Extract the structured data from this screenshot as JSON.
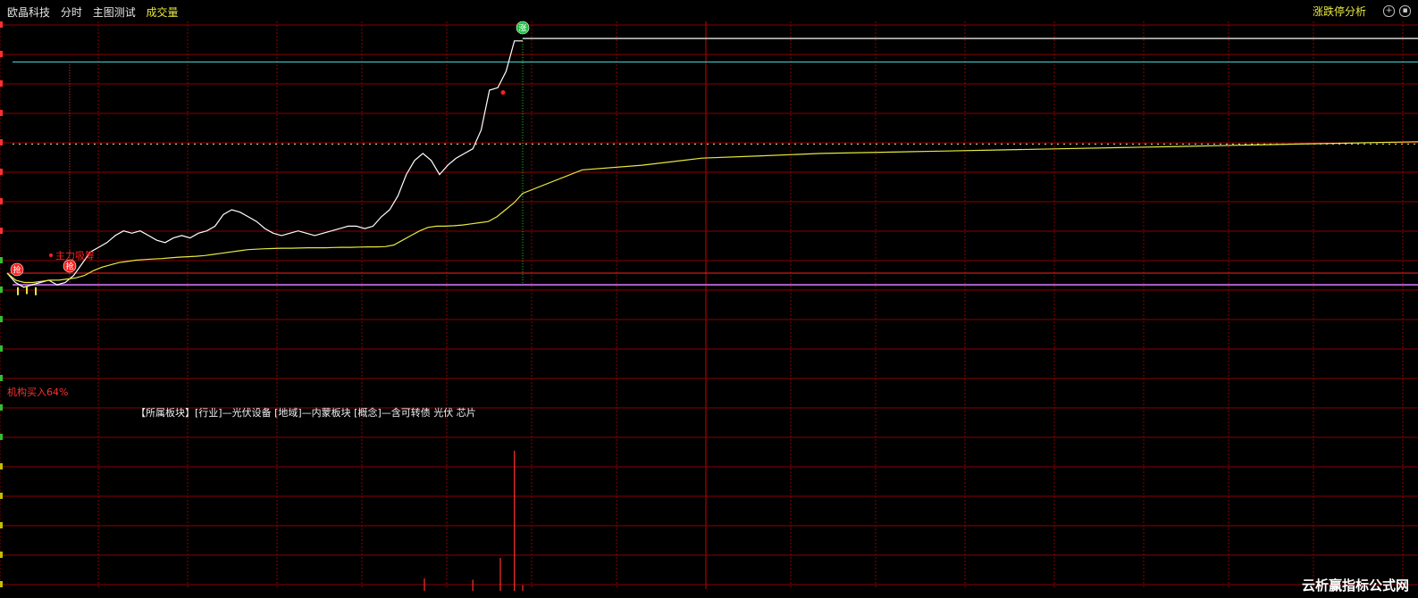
{
  "header": {
    "stock_name": "欧晶科技",
    "view_mode": "分时",
    "indicator_name": "主图测试",
    "volume_label": "成交量",
    "analysis_link": "涨跌停分析"
  },
  "annotations": {
    "main_buy_label": "主力吸筹",
    "institution_buy_label": "机构买入64%",
    "sector_line": "【所属板块】[行业]—光伏设备 [地域]—内蒙板块 [概念]—含可转债 光伏 芯片",
    "signal_low": "抢",
    "signal_limit": "涨"
  },
  "watermark": "云析赢指标公式网",
  "colors": {
    "grid": "#8b0000",
    "price_line": "#ffffff",
    "avg_line": "#e8e840",
    "limit_line": "#40c8c8",
    "support_line": "#b060d0",
    "dotted_line": "#e8e8a0",
    "volume_bar": "#ff3030",
    "signal_red": "#ff2020",
    "signal_green": "#20c040"
  },
  "chart_data": {
    "type": "line",
    "series": [
      {
        "values": [
          0.0,
          -0.4,
          -0.6,
          -0.5,
          -0.4,
          -0.3,
          -0.5,
          -0.4,
          -0.1,
          0.4,
          0.9,
          1.1,
          1.3,
          1.6,
          1.8,
          1.7,
          1.8,
          1.6,
          1.4,
          1.3,
          1.5,
          1.6,
          1.5,
          1.7,
          1.8,
          2.0,
          2.5,
          2.7,
          2.6,
          2.4,
          2.2,
          1.9,
          1.7,
          1.6,
          1.7,
          1.8,
          1.7,
          1.6,
          1.7,
          1.8,
          1.9,
          2.0,
          2.0,
          1.9,
          2.0,
          2.4,
          2.7,
          3.3,
          4.2,
          4.8,
          5.1,
          4.8,
          4.2,
          4.6,
          4.9,
          5.1,
          5.3,
          6.1,
          7.8,
          7.9,
          8.6,
          9.9,
          9.9
        ],
        "color": "#ffffff"
      },
      {
        "values": [
          0.0,
          -0.3,
          -0.4,
          -0.4,
          -0.35,
          -0.3,
          -0.3,
          -0.25,
          -0.2,
          -0.1,
          0.1,
          0.25,
          0.35,
          0.45,
          0.5,
          0.55,
          0.58,
          0.6,
          0.62,
          0.65,
          0.68,
          0.7,
          0.72,
          0.75,
          0.8,
          0.85,
          0.9,
          0.95,
          1.0,
          1.02,
          1.04,
          1.05,
          1.06,
          1.06,
          1.07,
          1.08,
          1.08,
          1.08,
          1.09,
          1.1,
          1.1,
          1.11,
          1.12,
          1.12,
          1.13,
          1.2,
          1.4,
          1.6,
          1.8,
          1.95,
          2.0,
          2.0,
          2.02,
          2.05,
          2.1,
          2.15,
          2.2,
          2.4,
          2.7,
          3.0,
          3.4,
          4.4,
          4.6,
          4.9,
          5.0,
          5.1,
          5.15,
          5.2,
          5.25,
          5.3,
          5.35,
          5.4,
          5.45,
          5.5,
          5.55,
          5.6
        ],
        "color": "#e8e840"
      }
    ],
    "reference_levels": {
      "prev_close": 0,
      "limit_up": 10,
      "dotted_level": 5.5,
      "support_level": -0.5,
      "price_high_line": 9.0
    },
    "ylim": [
      -7,
      10.5
    ],
    "volume": {
      "values": [
        0,
        0,
        0,
        0,
        0,
        0,
        0,
        0,
        0,
        0,
        0,
        0,
        0,
        0,
        0,
        0,
        0,
        0,
        0,
        0,
        0,
        0,
        0,
        0,
        0,
        0,
        0,
        0,
        0,
        0,
        0,
        0,
        0,
        0,
        0,
        0,
        0,
        0,
        0,
        0,
        0,
        0,
        0,
        0,
        0,
        0,
        0,
        0,
        0,
        0,
        0,
        0,
        0,
        0,
        0,
        0,
        8,
        0,
        0,
        0,
        0,
        100,
        4
      ],
      "color": "#ff3030"
    }
  }
}
